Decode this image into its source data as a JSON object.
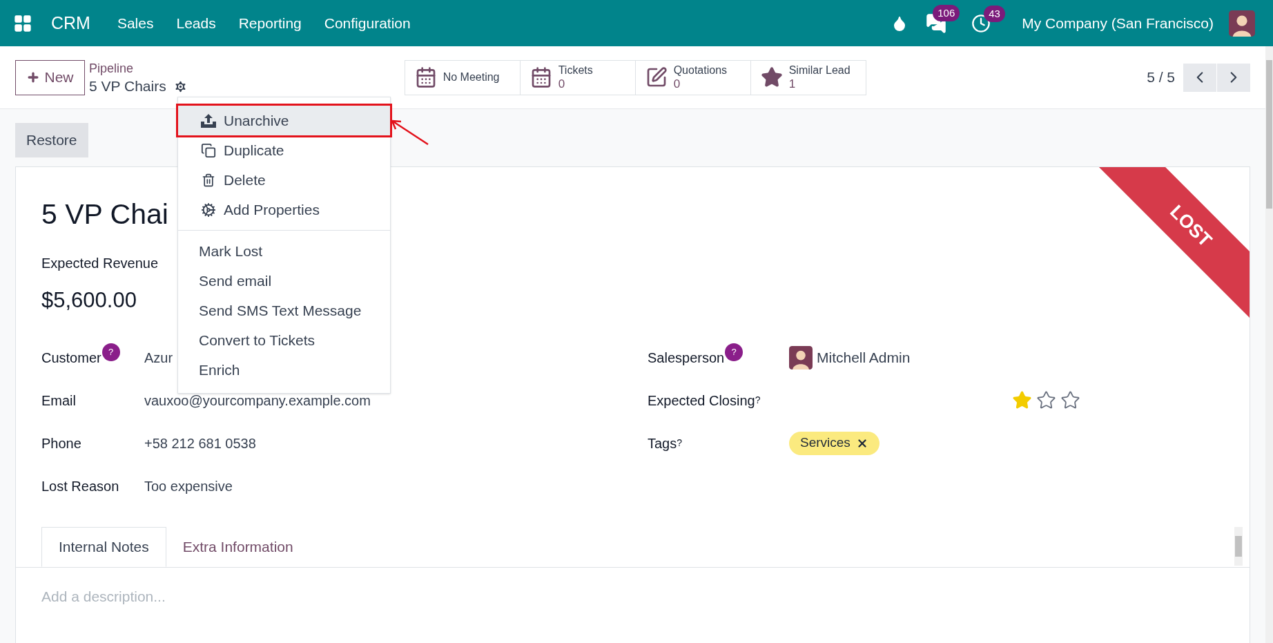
{
  "navbar": {
    "app": "CRM",
    "menus": [
      "Sales",
      "Leads",
      "Reporting",
      "Configuration"
    ],
    "messages_count": "106",
    "activities_count": "43",
    "company": "My Company (San Francisco)"
  },
  "control_panel": {
    "new_button": "New",
    "breadcrumb_parent": "Pipeline",
    "breadcrumb_current": "5 VP Chairs",
    "stat_buttons": [
      {
        "label": "No Meeting"
      },
      {
        "label": "Tickets",
        "value": "0"
      },
      {
        "label": "Quotations",
        "value": "0"
      },
      {
        "label": "Similar Lead",
        "value": "1"
      }
    ],
    "pager": "5 / 5"
  },
  "actions_menu": {
    "sections": [
      [
        {
          "label": "Unarchive",
          "highlighted": true
        },
        {
          "label": "Duplicate",
          "highlighted": false
        },
        {
          "label": "Delete",
          "highlighted": false
        },
        {
          "label": "Add Properties",
          "highlighted": false
        }
      ],
      [
        {
          "label": "Mark Lost",
          "highlighted": false
        },
        {
          "label": "Send email",
          "highlighted": false
        },
        {
          "label": "Send SMS Text Message",
          "highlighted": false
        },
        {
          "label": "Convert to Tickets",
          "highlighted": false
        },
        {
          "label": "Enrich",
          "highlighted": false
        }
      ]
    ]
  },
  "restore_button": "Restore",
  "form": {
    "title": "5 VP Chai",
    "revenue_label": "Expected Revenue",
    "revenue": "$5,600.00",
    "ribbon": "LOST",
    "left_fields": [
      {
        "label": "Customer",
        "help": "?",
        "help_badge": true,
        "value": "Azur"
      },
      {
        "label": "Email",
        "value": "vauxoo@yourcompany.example.com"
      },
      {
        "label": "Phone",
        "value": "+58 212 681 0538"
      },
      {
        "label": "Lost Reason",
        "value": "Too expensive"
      }
    ],
    "right_fields": [
      {
        "kind": "user",
        "label": "Salesperson",
        "help": "?",
        "help_badge": true,
        "value": "Mitchell Admin"
      },
      {
        "kind": "stars",
        "label": "Expected Closing",
        "help": "?",
        "help_badge": false,
        "stars": 1
      },
      {
        "kind": "tags",
        "label": "Tags",
        "help": "?",
        "help_badge": false,
        "tags": [
          {
            "label": "Services",
            "color": "#fbea7f"
          }
        ]
      }
    ]
  },
  "tabs": [
    {
      "label": "Internal Notes",
      "selected": true
    },
    {
      "label": "Extra Information",
      "selected": false
    }
  ],
  "notes_placeholder": "Add a description..."
}
